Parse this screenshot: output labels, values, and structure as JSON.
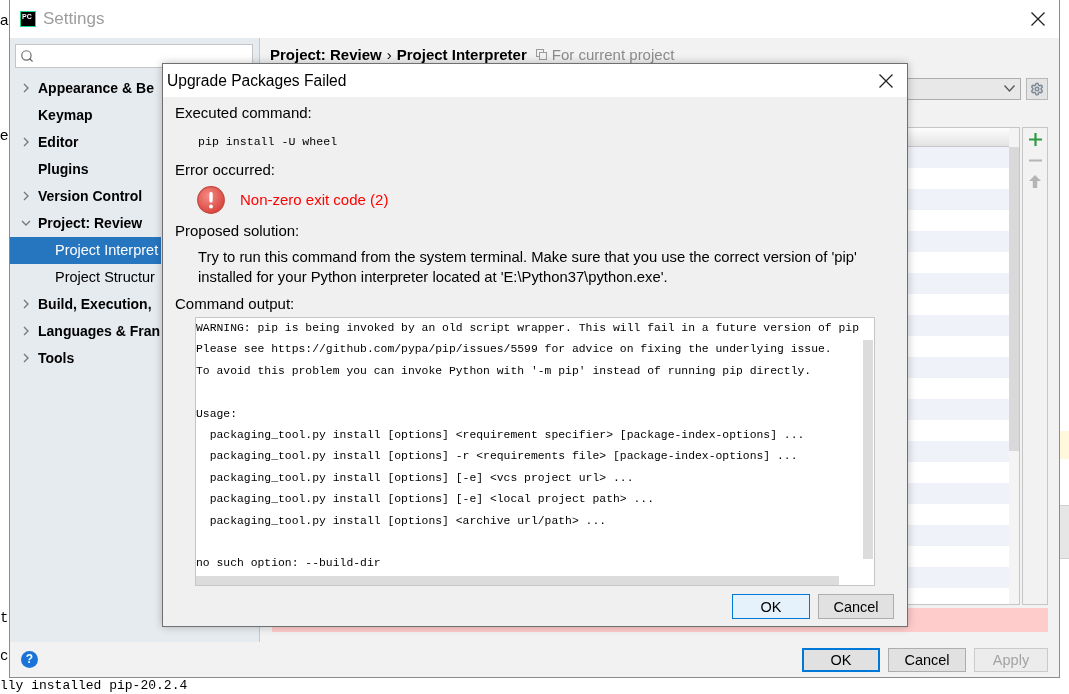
{
  "background": {
    "left_edge_texts": [
      "a",
      "e",
      "t",
      "c"
    ],
    "bottom_text": "lly installed pip-20.2.4"
  },
  "window": {
    "logo": "PC",
    "title": "Settings"
  },
  "sidebar": {
    "items": [
      {
        "label": "Appearance & Be",
        "kind": "group",
        "expanded": false,
        "selected": false
      },
      {
        "label": "Keymap",
        "kind": "page",
        "selected": false
      },
      {
        "label": "Editor",
        "kind": "group",
        "expanded": false,
        "selected": false
      },
      {
        "label": "Plugins",
        "kind": "page",
        "selected": false
      },
      {
        "label": "Version Control",
        "kind": "group",
        "expanded": false,
        "selected": false
      },
      {
        "label": "Project: Review",
        "kind": "group",
        "expanded": true,
        "selected": false,
        "children": [
          {
            "label": "Project Interpret",
            "kind": "page",
            "selected": true
          },
          {
            "label": "Project Structur",
            "kind": "page",
            "selected": false
          }
        ]
      },
      {
        "label": "Build, Execution,",
        "kind": "group",
        "expanded": false,
        "selected": false
      },
      {
        "label": "Languages & Fran",
        "kind": "group",
        "expanded": false,
        "selected": false
      },
      {
        "label": "Tools",
        "kind": "group",
        "expanded": false,
        "selected": false
      }
    ]
  },
  "breadcrumb": {
    "path": [
      "Project: Review",
      "Project Interpreter"
    ],
    "separator": "›",
    "scope": "For current project"
  },
  "package_tools": [
    {
      "kind": "add",
      "disabled": false
    },
    {
      "kind": "remove",
      "disabled": true
    },
    {
      "kind": "up",
      "disabled": true
    }
  ],
  "help": {
    "glyph": "?"
  },
  "buttons": [
    {
      "label": "OK",
      "default": true,
      "disabled": false
    },
    {
      "label": "Cancel",
      "default": false,
      "disabled": false
    },
    {
      "label": "Apply",
      "default": false,
      "disabled": true
    }
  ],
  "dialog": {
    "title": "Upgrade Packages Failed",
    "executed_label": "Executed command:",
    "command": "pip install -U wheel",
    "error_label": "Error occurred:",
    "error_message": "Non-zero exit code (2)",
    "solution_label": "Proposed solution:",
    "solution_lines": [
      "Try to run this command from the system terminal. Make sure that you use the correct version of 'pip'",
      "installed for your Python interpreter located at 'E:\\Python37\\python.exe'."
    ],
    "output_label": "Command output:",
    "output": "WARNING: pip is being invoked by an old script wrapper. This will fail in a future version of pip\nPlease see https://github.com/pypa/pip/issues/5599 for advice on fixing the underlying issue.\nTo avoid this problem you can invoke Python with '-m pip' instead of running pip directly.\n\nUsage:\n  packaging_tool.py install [options] <requirement specifier> [package-index-options] ...\n  packaging_tool.py install [options] -r <requirements file> [package-index-options] ...\n  packaging_tool.py install [options] [-e] <vcs project url> ...\n  packaging_tool.py install [options] [-e] <local project path> ...\n  packaging_tool.py install [options] <archive url/path> ...\n\nno such option: --build-dir",
    "buttons": [
      {
        "label": "OK",
        "default": true
      },
      {
        "label": "Cancel",
        "default": false
      }
    ]
  }
}
